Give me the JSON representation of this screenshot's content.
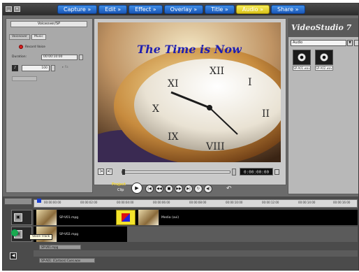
{
  "window": {
    "minimize_glyph": "▁",
    "close_glyph": "✕"
  },
  "steps": [
    {
      "label": "Capture »",
      "active": false
    },
    {
      "label": "Edit »",
      "active": false
    },
    {
      "label": "Effect »",
      "active": false
    },
    {
      "label": "Overlay »",
      "active": false
    },
    {
      "label": "Title »",
      "active": false
    },
    {
      "label": "Audio »",
      "active": true
    },
    {
      "label": "Share »",
      "active": false
    }
  ],
  "options": {
    "title": "Voiceover/SP",
    "tabs": [
      "Voiceover",
      "Music"
    ],
    "record_label": "Record Voice",
    "duration_label": "Duration:",
    "duration_value": "00:00:10:00",
    "volume_value": "100",
    "fade_label": "▸ Fa"
  },
  "preview": {
    "caption": "The Time is Now",
    "timecode": "0:00:00:00",
    "buttons": {
      "start": "|◂",
      "end": "▸|"
    }
  },
  "navigation": {
    "project_label": "Project",
    "clip_label": "Clip",
    "play": "▶",
    "home": "|◀",
    "prev": "◀◀",
    "stop": "■",
    "next": "▶▶",
    "end": "▶|",
    "repeat": "↻",
    "volume": "◀)",
    "undo": "↶"
  },
  "library": {
    "brand": "VideoStudio 7",
    "dropdown_value": "Audio",
    "items": [
      {
        "label": "SP-A01.wav",
        "icon": "cd-audio-icon"
      },
      {
        "label": "SP-A02.wav",
        "icon": "cd-audio-icon"
      }
    ]
  },
  "timeline": {
    "ruler_ticks": [
      "00:00:00:00",
      "00:00:02:00",
      "00:00:04:00",
      "00:00:06:00",
      "00:00:08:00",
      "00:00:10:00",
      "00:00:12:00",
      "00:00:14:00",
      "00:00:16:00"
    ],
    "clips": [
      {
        "name": "SP-V01.mpg"
      },
      {
        "name": "Media (avi)"
      },
      {
        "name": "SP-V02.mpg"
      }
    ],
    "tooltip": "Voice Track",
    "audio_tracks": [
      "SP-V01.mpg",
      "SP-A01: (Cartoon) Cues.wav"
    ]
  }
}
